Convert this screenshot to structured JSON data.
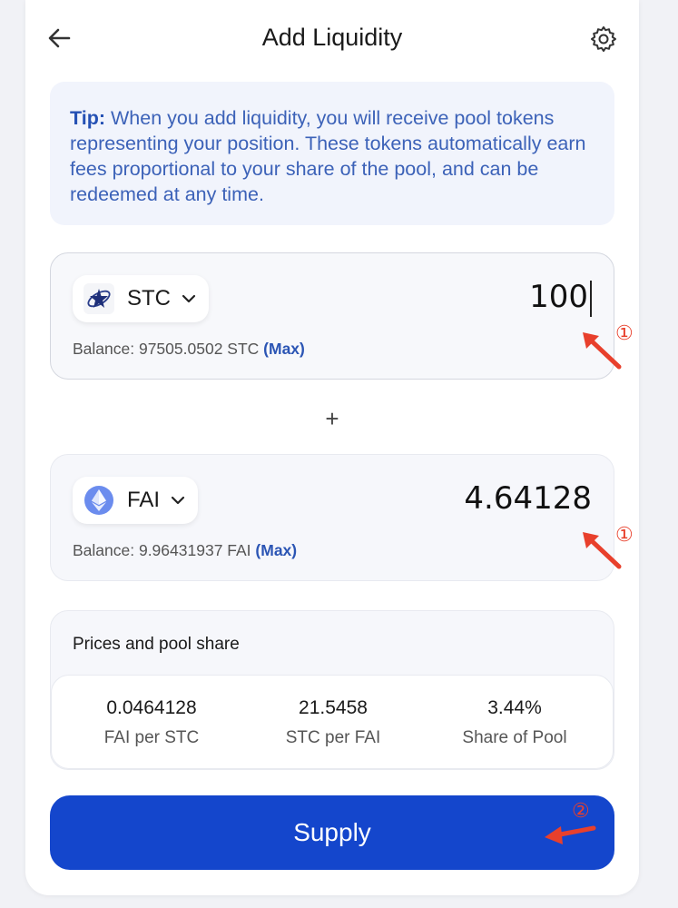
{
  "header": {
    "title": "Add Liquidity"
  },
  "tip": {
    "label": "Tip:",
    "text": " When you add liquidity, you will receive pool tokens representing your position. These tokens automatically earn fees proportional to your share of the pool, and can be redeemed at any time."
  },
  "token_a": {
    "symbol": "STC",
    "amount": "100",
    "balance_label": "Balance: 97505.0502 STC",
    "max_label": "(Max)",
    "icon": "stc-token-icon"
  },
  "plus_sign": "+",
  "token_b": {
    "symbol": "FAI",
    "amount": "4.64128",
    "balance_label": "Balance: 9.96431937 FAI",
    "max_label": "(Max)",
    "icon": "ethereum-token-icon"
  },
  "prices": {
    "title": "Prices and pool share",
    "stats": [
      {
        "value": "0.0464128",
        "label": "FAI per STC"
      },
      {
        "value": "21.5458",
        "label": "STC per FAI"
      },
      {
        "value": "3.44%",
        "label": "Share of Pool"
      }
    ]
  },
  "supply_label": "Supply",
  "annotations": {
    "step1": "①",
    "step2": "②",
    "color": "#e8402c"
  },
  "colors": {
    "accent": "#1446cc",
    "link": "#2b55b4"
  }
}
